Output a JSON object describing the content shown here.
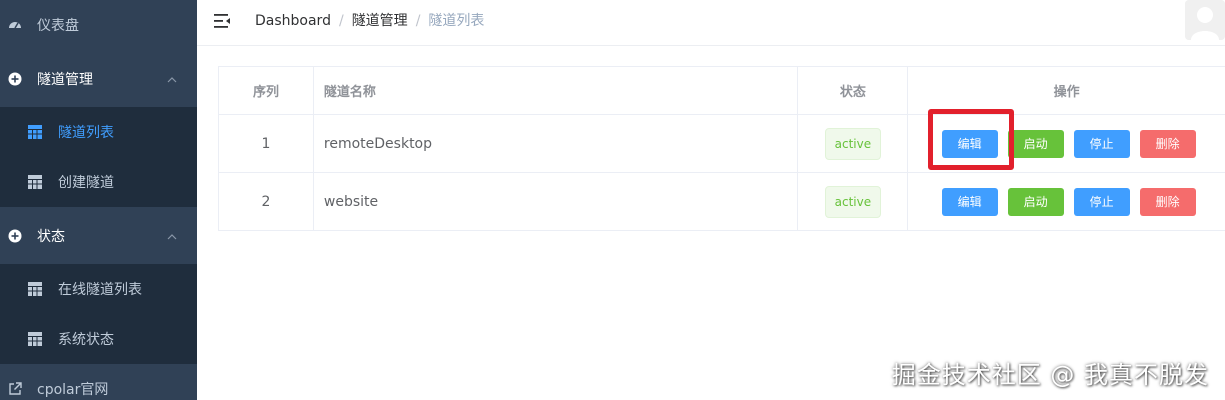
{
  "sidebar": {
    "dashboard": {
      "label": "仪表盘",
      "icon": "dashboard-icon"
    },
    "groups": [
      {
        "label": "隧道管理",
        "icon": "circle-plus-icon",
        "items": [
          {
            "label": "隧道列表",
            "active": true,
            "icon": "grid-icon"
          },
          {
            "label": "创建隧道",
            "active": false,
            "icon": "grid-icon"
          }
        ]
      },
      {
        "label": "状态",
        "icon": "circle-plus-icon",
        "items": [
          {
            "label": "在线隧道列表",
            "active": false,
            "icon": "grid-icon"
          },
          {
            "label": "系统状态",
            "active": false,
            "icon": "grid-icon"
          }
        ]
      }
    ],
    "external": {
      "label": "cpolar官网",
      "icon": "external-link-icon"
    }
  },
  "header": {
    "breadcrumb": [
      "Dashboard",
      "隧道管理",
      "隧道列表"
    ],
    "separator": "/"
  },
  "table": {
    "columns": [
      "序列",
      "隧道名称",
      "状态",
      "操作"
    ],
    "rows": [
      {
        "index": "1",
        "name": "remoteDesktop",
        "status": "active"
      },
      {
        "index": "2",
        "name": "website",
        "status": "active"
      }
    ],
    "actions": {
      "edit": "编辑",
      "start": "启动",
      "stop": "停止",
      "delete": "删除"
    }
  },
  "watermark": "掘金技术社区 @ 我真不脱发",
  "colors": {
    "sidebar_bg": "#304156",
    "submenu_bg": "#1f2d3d",
    "active": "#409eff",
    "success": "#67c23a",
    "danger": "#f56c6c",
    "highlight": "#e2202c"
  }
}
